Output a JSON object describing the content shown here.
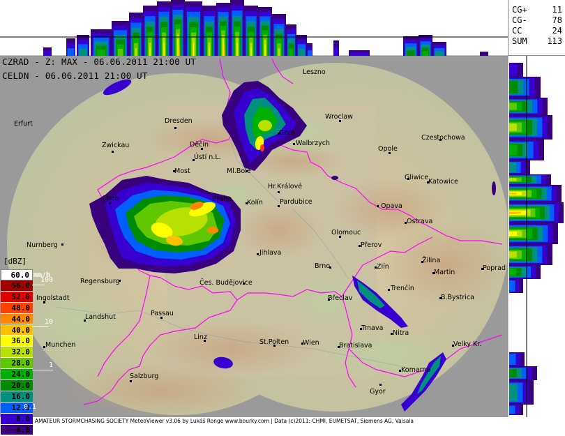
{
  "header": {
    "line1": "CZRAD - Z: MAX - 06.06.2011 21:00 UT",
    "line2": "CELDN - 06.06.2011 21:00 UT"
  },
  "lightning_stats": [
    {
      "key": "CG+",
      "value": "11"
    },
    {
      "key": "CG-",
      "value": "78"
    },
    {
      "key": "CC",
      "value": "24"
    },
    {
      "key": "SUM",
      "value": "113"
    }
  ],
  "legend": {
    "title": "[dBZ]",
    "entries": [
      {
        "label": "60.0",
        "color": "#ffffff",
        "text_color": "#000000"
      },
      {
        "label": "56.0",
        "color": "#a00000",
        "text_color": "#000000"
      },
      {
        "label": "52.0",
        "color": "#e00000",
        "text_color": "#000000"
      },
      {
        "label": "48.0",
        "color": "#ff4000",
        "text_color": "#000000"
      },
      {
        "label": "44.0",
        "color": "#ff8800",
        "text_color": "#000000"
      },
      {
        "label": "40.0",
        "color": "#ffc000",
        "text_color": "#000000"
      },
      {
        "label": "36.0",
        "color": "#ffff00",
        "text_color": "#000000"
      },
      {
        "label": "32.0",
        "color": "#b8e000",
        "text_color": "#000000"
      },
      {
        "label": "28.0",
        "color": "#60c800",
        "text_color": "#000000"
      },
      {
        "label": "24.0",
        "color": "#00b000",
        "text_color": "#000000"
      },
      {
        "label": "20.0",
        "color": "#008c00",
        "text_color": "#000000"
      },
      {
        "label": "16.0",
        "color": "#009080",
        "text_color": "#000000"
      },
      {
        "label": "12.0",
        "color": "#0060ff",
        "text_color": "#000000"
      },
      {
        "label": "8.0",
        "color": "#3800d0",
        "text_color": "#000000"
      },
      {
        "label": "4.0",
        "color": "#38007c",
        "text_color": "#000000"
      }
    ],
    "rain_title": "mm/h",
    "rain_labels": [
      "100",
      "10",
      "1",
      "0.1"
    ]
  },
  "cities": [
    {
      "name": "Leszno",
      "dot": false
    },
    {
      "name": "Wroclaw",
      "dot": true
    },
    {
      "name": "Erfurt",
      "dot": false
    },
    {
      "name": "Dresden",
      "dot": true
    },
    {
      "name": "Gora",
      "dot": true
    },
    {
      "name": "Zwickau",
      "dot": true
    },
    {
      "name": "Děčín",
      "dot": true
    },
    {
      "name": "Walbrzych",
      "dot": true
    },
    {
      "name": "Opole",
      "dot": true
    },
    {
      "name": "Czestochowa",
      "dot": true
    },
    {
      "name": "Ústí n.L.",
      "dot": true
    },
    {
      "name": "Most",
      "dot": true
    },
    {
      "name": "Ml.Bole",
      "dot": true
    },
    {
      "name": "Gliwice",
      "dot": true
    },
    {
      "name": "Katowice",
      "dot": true
    },
    {
      "name": "Hr.Králové",
      "dot": true
    },
    {
      "name": "Cheb",
      "dot": true
    },
    {
      "name": "Praha",
      "dot": false
    },
    {
      "name": "Kolín",
      "dot": true
    },
    {
      "name": "Pardubice",
      "dot": true
    },
    {
      "name": "Opava",
      "dot": true
    },
    {
      "name": "Ostrava",
      "dot": true
    },
    {
      "name": "Olomouc",
      "dot": true
    },
    {
      "name": "Nurnberg",
      "dot": true
    },
    {
      "name": "Přerov",
      "dot": true
    },
    {
      "name": "Jihlava",
      "dot": true
    },
    {
      "name": "Žilina",
      "dot": true
    },
    {
      "name": "Brno",
      "dot": true
    },
    {
      "name": "Zlín",
      "dot": true
    },
    {
      "name": "Martin",
      "dot": true
    },
    {
      "name": "Poprad",
      "dot": true
    },
    {
      "name": "Regensburg",
      "dot": true
    },
    {
      "name": "Čes. Budějovice",
      "dot": true
    },
    {
      "name": "Trenčín",
      "dot": true
    },
    {
      "name": "Ingolstadt",
      "dot": true
    },
    {
      "name": "Břeclav",
      "dot": true
    },
    {
      "name": "B.Bystrica",
      "dot": true
    },
    {
      "name": "Passau",
      "dot": true
    },
    {
      "name": "Landshut",
      "dot": true
    },
    {
      "name": "Trnava",
      "dot": true
    },
    {
      "name": "Nitra",
      "dot": true
    },
    {
      "name": "Linz",
      "dot": true
    },
    {
      "name": "Munchen",
      "dot": true
    },
    {
      "name": "St.Polten",
      "dot": true
    },
    {
      "name": "Wien",
      "dot": true
    },
    {
      "name": "Velky Kr.",
      "dot": true
    },
    {
      "name": "Bratislava",
      "dot": true
    },
    {
      "name": "Salzburg",
      "dot": true
    },
    {
      "name": "Komarno",
      "dot": true
    },
    {
      "name": "Gyor",
      "dot": true
    }
  ],
  "footer": "AMATEUR STORMCHASING SOCIETY MeteoViewer v3.06 by Lukáš Ronge www.bourky.com | Data (c)2011: CHMI, EUMETSAT, Siemens AG, Vaisala",
  "colors": {
    "background": "#ffffff",
    "map_terrain": "#c8bea8",
    "outside_range": "#9a9a9a",
    "border_line": "#ff00ff"
  }
}
